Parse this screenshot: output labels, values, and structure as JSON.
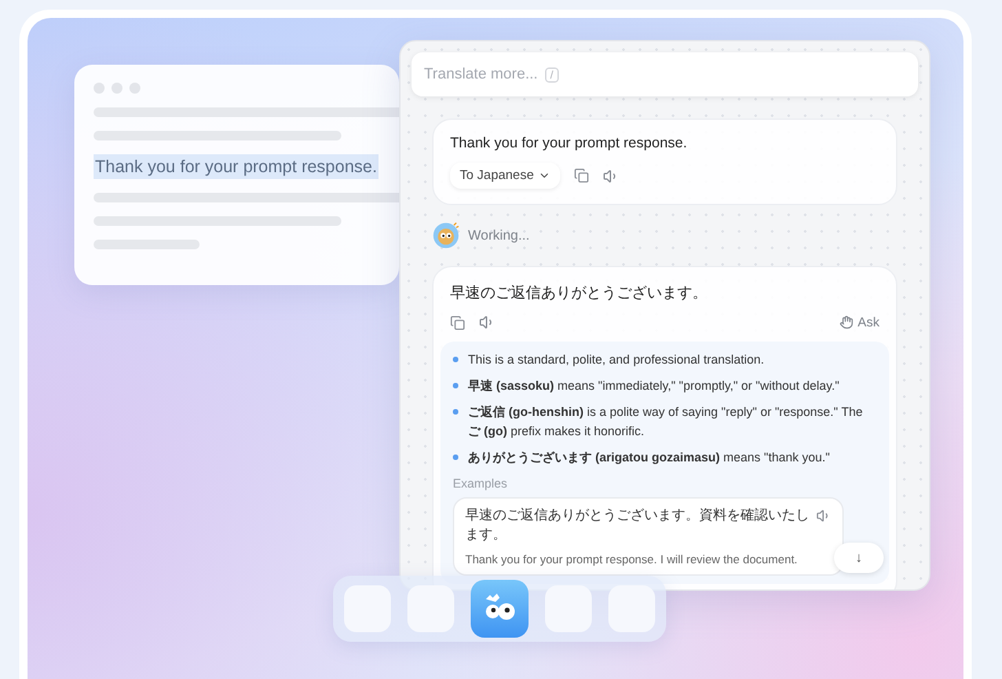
{
  "source_window": {
    "selected_text": "Thank you for your prompt response."
  },
  "panel": {
    "search": {
      "placeholder": "Translate more...",
      "shortcut": "/"
    },
    "source": {
      "text": "Thank you for your prompt response.",
      "language": "To Japanese"
    },
    "status": "Working...",
    "result": {
      "text": "早速のご返信ありがとうございます。",
      "ask": "Ask"
    },
    "notes": [
      "This is a standard, polite, and professional translation.",
      "**早速 (sassoku)** means \"immediately,\" \"promptly,\" or \"without delay.\"",
      "**ご返信 (go-henshin)** is a polite way of saying \"reply\" or \"response.\" The **ご (go)** prefix makes it honorific.",
      "**ありがとうございます (arigatou gozaimasu)** means \"thank you.\""
    ],
    "examples_label": "Examples",
    "examples": [
      {
        "text": "早速のご返信ありがとうございます。資料を確認いたします。",
        "translation": "Thank you for your prompt response. I will review the document."
      }
    ],
    "scroll_glyph": "↓"
  },
  "dock": {
    "items": [
      {
        "kind": "blank"
      },
      {
        "kind": "blank"
      },
      {
        "kind": "app"
      },
      {
        "kind": "blank"
      },
      {
        "kind": "blank"
      }
    ]
  }
}
